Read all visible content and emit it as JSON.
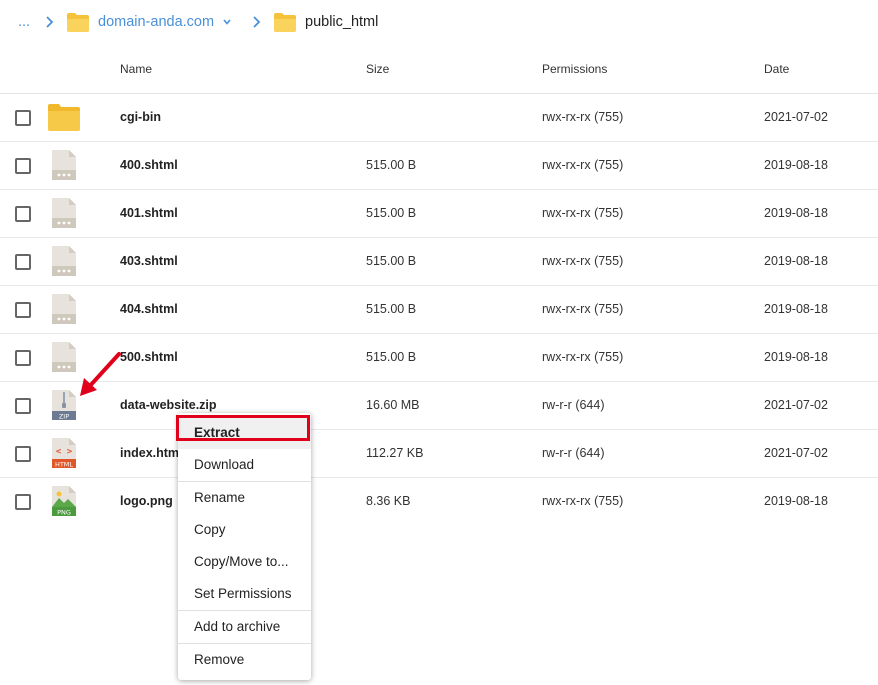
{
  "breadcrumb": {
    "ellipsis": "...",
    "domain": "domain-anda.com",
    "current": "public_html"
  },
  "columns": {
    "name": "Name",
    "size": "Size",
    "permissions": "Permissions",
    "date": "Date"
  },
  "files": [
    {
      "name": "cgi-bin",
      "size": "",
      "permissions": "rwx-rx-rx (755)",
      "date": "2021-07-02",
      "icon": "folder-icon"
    },
    {
      "name": "400.shtml",
      "size": "515.00 B",
      "permissions": "rwx-rx-rx (755)",
      "date": "2019-08-18",
      "icon": "file-icon"
    },
    {
      "name": "401.shtml",
      "size": "515.00 B",
      "permissions": "rwx-rx-rx (755)",
      "date": "2019-08-18",
      "icon": "file-icon"
    },
    {
      "name": "403.shtml",
      "size": "515.00 B",
      "permissions": "rwx-rx-rx (755)",
      "date": "2019-08-18",
      "icon": "file-icon"
    },
    {
      "name": "404.shtml",
      "size": "515.00 B",
      "permissions": "rwx-rx-rx (755)",
      "date": "2019-08-18",
      "icon": "file-icon"
    },
    {
      "name": "500.shtml",
      "size": "515.00 B",
      "permissions": "rwx-rx-rx (755)",
      "date": "2019-08-18",
      "icon": "file-icon"
    },
    {
      "name": "data-website.zip",
      "size": "16.60 MB",
      "permissions": "rw-r-r (644)",
      "date": "2021-07-02",
      "icon": "zip-file-icon",
      "icon_label": "ZIP"
    },
    {
      "name": "index.html",
      "size": "112.27 KB",
      "permissions": "rw-r-r (644)",
      "date": "2021-07-02",
      "icon": "html-file-icon",
      "icon_label": "HTML",
      "icon_symbol": "< >"
    },
    {
      "name": "logo.png",
      "size": "8.36 KB",
      "permissions": "rwx-rx-rx (755)",
      "date": "2019-08-18",
      "icon": "png-file-icon",
      "icon_label": "PNG"
    }
  ],
  "context_menu": {
    "extract": "Extract",
    "download": "Download",
    "rename": "Rename",
    "copy": "Copy",
    "copy_move": "Copy/Move to...",
    "set_permissions": "Set Permissions",
    "add_to_archive": "Add to archive",
    "remove": "Remove"
  },
  "colors": {
    "link": "#4a90d9",
    "folder": "#f5c33b",
    "highlight_border": "#e0001b",
    "arrow": "#e0001b"
  }
}
